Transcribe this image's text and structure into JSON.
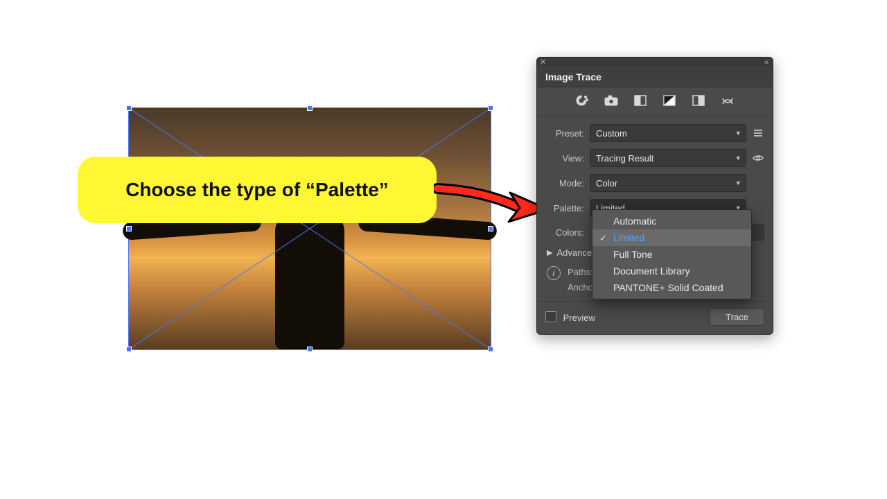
{
  "callout": {
    "text": "Choose the type of “Palette”"
  },
  "panel": {
    "title": "Image Trace",
    "preset": {
      "label": "Preset:",
      "value": "Custom"
    },
    "view": {
      "label": "View:",
      "value": "Tracing Result"
    },
    "mode": {
      "label": "Mode:",
      "value": "Color"
    },
    "palette": {
      "label": "Palette:",
      "value": "Limited"
    },
    "colors_label": "Colors:",
    "advanced_label": "Advanced",
    "info": {
      "paths_label": "Paths:",
      "anchors_label": "Anchors:"
    },
    "preview_label": "Preview",
    "trace_button": "Trace",
    "palette_options": [
      {
        "label": "Automatic",
        "selected": false
      },
      {
        "label": "Limited",
        "selected": true
      },
      {
        "label": "Full Tone",
        "selected": false
      },
      {
        "label": "Document Library",
        "selected": false
      },
      {
        "label": "PANTONE+ Solid Coated",
        "selected": false
      }
    ]
  }
}
